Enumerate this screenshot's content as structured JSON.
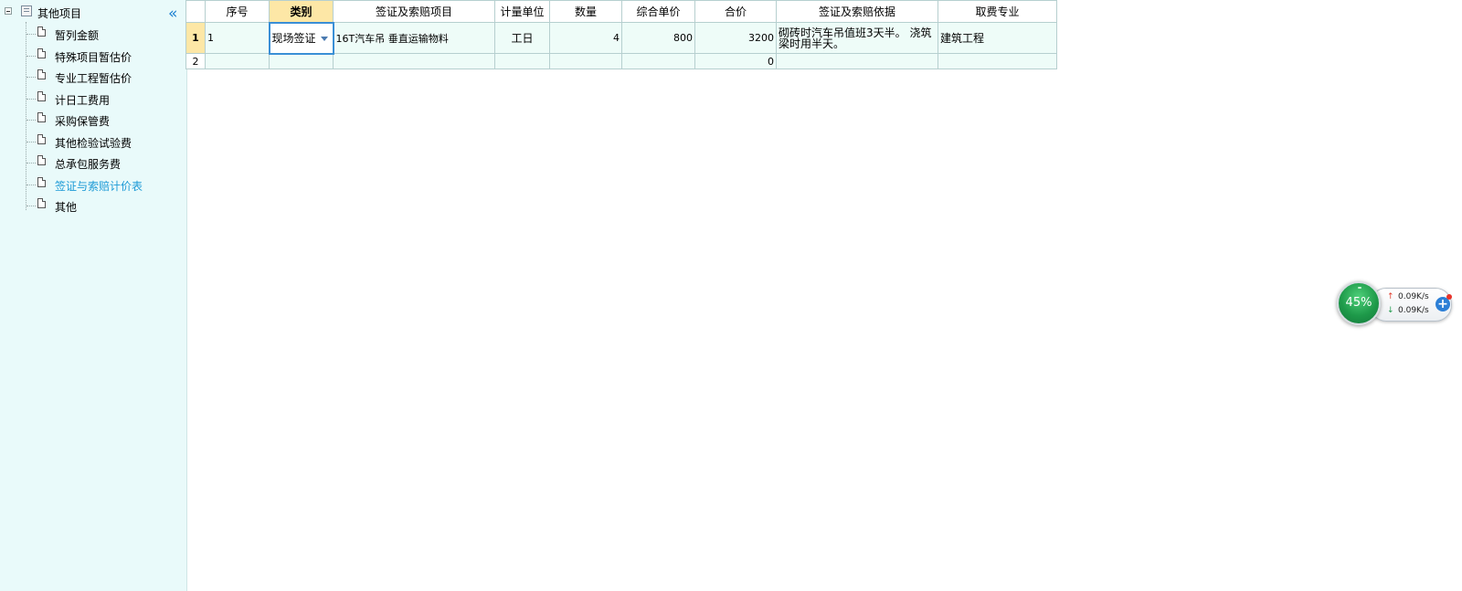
{
  "tree": {
    "root_label": "其他项目",
    "collapse_glyph": "«",
    "items": [
      {
        "label": "暂列金额"
      },
      {
        "label": "特殊项目暂估价"
      },
      {
        "label": "专业工程暂估价"
      },
      {
        "label": "计日工费用"
      },
      {
        "label": "采购保管费"
      },
      {
        "label": "其他检验试验费"
      },
      {
        "label": "总承包服务费"
      },
      {
        "label": "签证与索赔计价表",
        "selected": true
      },
      {
        "label": "其他"
      }
    ]
  },
  "grid": {
    "columns": [
      "序号",
      "类别",
      "签证及索赔项目",
      "计量单位",
      "数量",
      "综合单价",
      "合价",
      "签证及索赔依据",
      "取费专业"
    ],
    "active_column": "类别",
    "rows": [
      {
        "row_number": "1",
        "seq": "1",
        "category": "现场签证",
        "item": "16T汽车吊 垂直运输物料",
        "unit": "工日",
        "quantity": "4",
        "unit_price": "800",
        "total": "3200",
        "basis": "砌砖时汽车吊值班3天半。 浇筑梁时用半天。",
        "specialty": "建筑工程"
      },
      {
        "row_number": "2",
        "seq": "",
        "category": "",
        "item": "",
        "unit": "",
        "quantity": "",
        "unit_price": "",
        "total": "0",
        "basis": "",
        "specialty": ""
      }
    ]
  },
  "net_widget": {
    "percent": "45%",
    "upload": "0.09K/s",
    "download": "0.09K/s",
    "up_icon": "arrow-up-icon",
    "down_icon": "arrow-down-icon",
    "plus": "+"
  },
  "colors": {
    "tree_bg": "#e9fafa",
    "cell_bg": "#eefcf8",
    "active_header": "#fde7a6",
    "selected_text": "#1d9ad6",
    "edit_border": "#3a8fd6",
    "widget_green": "#1e9a4a"
  }
}
